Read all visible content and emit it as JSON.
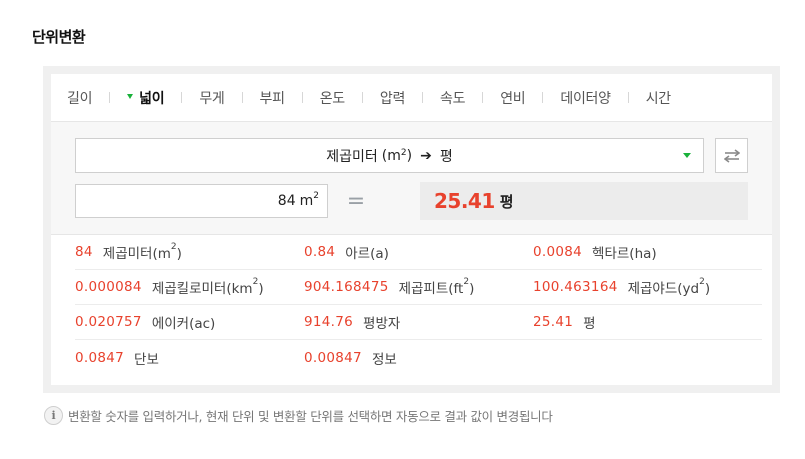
{
  "section_title": "단위변환",
  "tabs": [
    {
      "label": "길이",
      "active": false
    },
    {
      "label": "넓이",
      "active": true
    },
    {
      "label": "무게",
      "active": false
    },
    {
      "label": "부피",
      "active": false
    },
    {
      "label": "온도",
      "active": false
    },
    {
      "label": "압력",
      "active": false
    },
    {
      "label": "속도",
      "active": false
    },
    {
      "label": "연비",
      "active": false
    },
    {
      "label": "데이터양",
      "active": false
    },
    {
      "label": "시간",
      "active": false
    }
  ],
  "converter": {
    "from_unit": "제곱미터",
    "from_symbol": "(m",
    "from_symbol_sup": "2",
    "from_symbol_close": ")",
    "arrow": "➔",
    "to_unit": "평",
    "input_value": "84",
    "input_unit": "m",
    "input_unit_sup": "2",
    "equals": "=",
    "result_value": "25.41",
    "result_unit": "평"
  },
  "results": [
    [
      {
        "num": "84",
        "unit": "제곱미터(m",
        "sup": "2",
        "close": ")"
      },
      {
        "num": "0.84",
        "unit": "아르(a)",
        "sup": "",
        "close": ""
      },
      {
        "num": "0.0084",
        "unit": "헥타르(ha)",
        "sup": "",
        "close": ""
      }
    ],
    [
      {
        "num": "0.000084",
        "unit": "제곱킬로미터(km",
        "sup": "2",
        "close": ")"
      },
      {
        "num": "904.168475",
        "unit": "제곱피트(ft",
        "sup": "2",
        "close": ")"
      },
      {
        "num": "100.463164",
        "unit": "제곱야드(yd",
        "sup": "2",
        "close": ")"
      }
    ],
    [
      {
        "num": "0.020757",
        "unit": "에이커(ac)",
        "sup": "",
        "close": ""
      },
      {
        "num": "914.76",
        "unit": "평방자",
        "sup": "",
        "close": ""
      },
      {
        "num": "25.41",
        "unit": "평",
        "sup": "",
        "close": ""
      }
    ],
    [
      {
        "num": "0.0847",
        "unit": "단보",
        "sup": "",
        "close": ""
      },
      {
        "num": "0.00847",
        "unit": "정보",
        "sup": "",
        "close": ""
      }
    ]
  ],
  "hint": {
    "icon_label": "i",
    "text": "변환할 숫자를 입력하거나, 현재 단위 및 변환할 단위를 선택하면 자동으로 결과 값이 변경됩니다"
  },
  "colors": {
    "accent_red": "#e8422d",
    "accent_green": "#19b13a"
  }
}
